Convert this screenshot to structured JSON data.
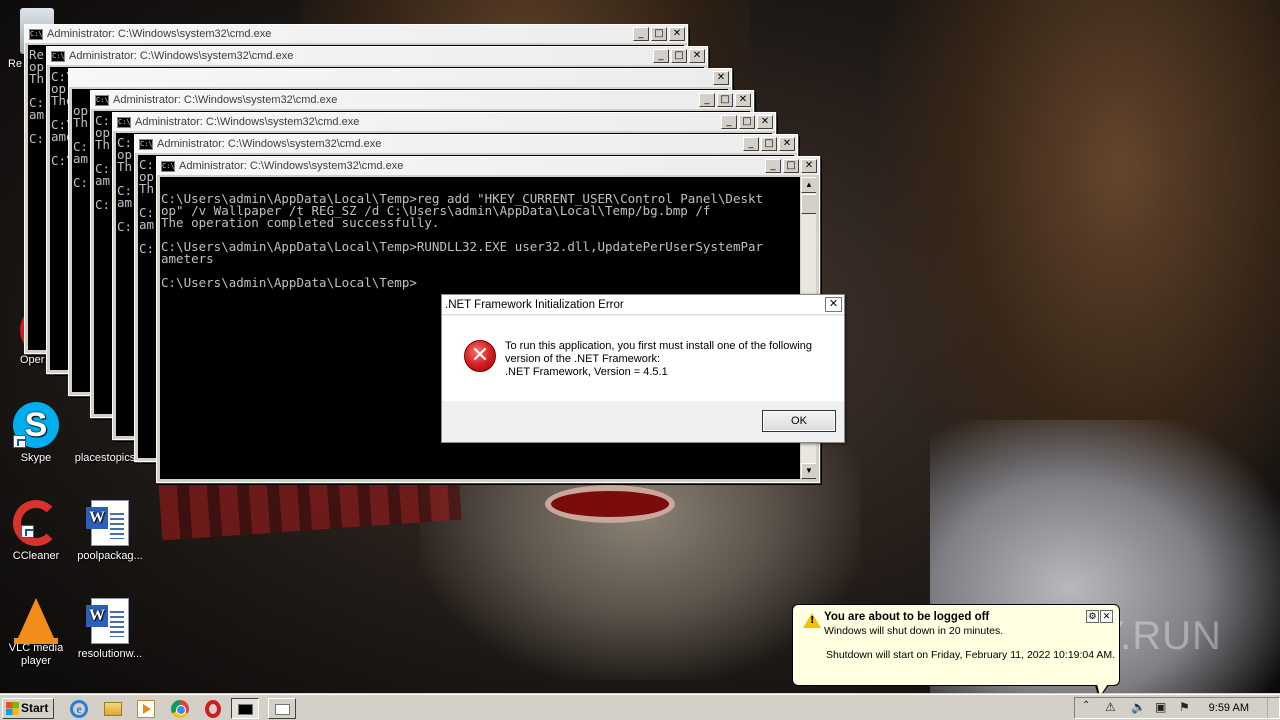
{
  "colors": {
    "console_bg": "#000000",
    "console_text": "#c0c0c0",
    "error_red": "#d01c1c",
    "balloon_bg": "#ffffe1"
  },
  "desktop_icons": [
    {
      "label": "Re",
      "icon": "recycle-bin-icon"
    },
    {
      "label": "Oper",
      "icon": "opera-icon"
    },
    {
      "label": "Skype",
      "icon": "skype-icon"
    },
    {
      "label": "placestopics",
      "icon": "document-icon"
    },
    {
      "label": "CCleaner",
      "icon": "ccleaner-icon"
    },
    {
      "label": "poolpackag...",
      "icon": "word-document-icon"
    },
    {
      "label": "VLC media player",
      "icon": "vlc-icon"
    },
    {
      "label": "resolutionw...",
      "icon": "word-document-icon"
    }
  ],
  "cmd_windows": [
    {
      "title": "Administrator: C:\\Windows\\system32\\cmd.exe"
    },
    {
      "title": "Administrator: C:\\Windows\\system32\\cmd.exe"
    },
    {
      "title": "Administrator: C:\\Windows\\system32\\cmd.exe"
    },
    {
      "title": "Administrator: C:\\Windows\\system32\\cmd.exe"
    },
    {
      "title": "Administrator: C:\\Windows\\system32\\cmd.exe"
    },
    {
      "title": "Administrator: C:\\Windows\\system32\\cmd.exe"
    }
  ],
  "console_fragments": {
    "w1": "Re\nop\nTh\n\nC:\nam\n\nC:",
    "w2": "C:\\Users\\admin\\AppData\\Local\\Temp>reg add \"HKEY_CURRENT_USER\\Control Panel\\Deskt\nop\" /\nThe o\n\nC:\\Us\nameter\n\nC:\\Us",
    "w3": "\nop\nTh\n\nC:\nam\n\nC:",
    "w4": "C:\nop\nTh\n\nC:\nam\n\nC:",
    "w5": "C:\nop\nTh\n\nC:\nam\n\nC:"
  },
  "front_console": {
    "lines": [
      "",
      "C:\\Users\\admin\\AppData\\Local\\Temp>reg add \"HKEY_CURRENT_USER\\Control Panel\\Deskt",
      "op\" /v Wallpaper /t REG_SZ /d C:\\Users\\admin\\AppData\\Local\\Temp/bg.bmp /f",
      "The operation completed successfully.",
      "",
      "C:\\Users\\admin\\AppData\\Local\\Temp>RUNDLL32.EXE user32.dll,UpdatePerUserSystemPar",
      "ameters",
      "",
      "C:\\Users\\admin\\AppData\\Local\\Temp>"
    ]
  },
  "dialog": {
    "title": ".NET Framework Initialization Error",
    "close": "✕",
    "message_line1": "To run this application, you first must install one of the following",
    "message_line2": "version of the .NET Framework:",
    "message_line3": ".NET Framework, Version = 4.5.1",
    "ok_label": "OK"
  },
  "balloon": {
    "title": "You are about to be logged off",
    "line1": "Windows will shut down in 20 minutes.",
    "line2": "Shutdown will start on Friday, February 11, 2022 10:19:04 AM."
  },
  "watermark": "ANY.RUN",
  "taskbar": {
    "start_label": "Start",
    "quick_launch": [
      "ie-icon",
      "folder-icon",
      "media-player-icon",
      "chrome-icon",
      "opera-icon"
    ],
    "clock": "9:59 AM"
  }
}
